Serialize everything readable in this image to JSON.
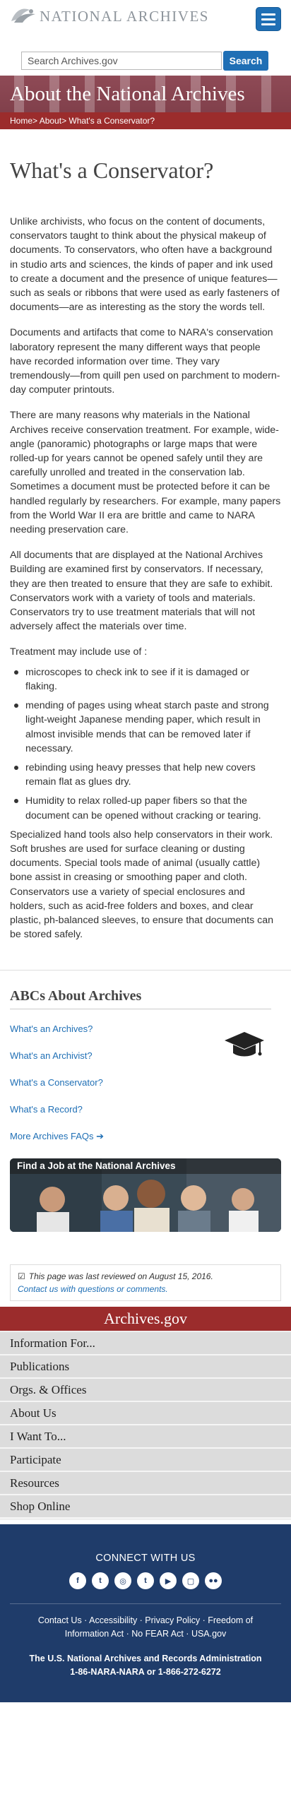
{
  "header": {
    "logo_text": "NATIONAL ARCHIVES",
    "menu_icon": "hamburger-icon",
    "search_placeholder": "Search Archives.gov",
    "search_button": "Search"
  },
  "banner": {
    "title": "About the National Archives",
    "breadcrumb": [
      "Home",
      ">",
      "About",
      ">",
      "What's a Conservator?"
    ]
  },
  "page": {
    "title": "What's a Conservator?",
    "paragraphs": [
      "Unlike archivists, who focus on the content of documents, conservators taught to think about the physical makeup of documents. To conservators, who often have a background in studio arts and sciences, the kinds of paper and ink used to create a document and the presence of unique features—such as seals or ribbons that were used as early fasteners of documents—are as interesting as the story the words tell.",
      "Documents and artifacts that come to NARA's conservation laboratory represent the many different ways that people have recorded information over time. They vary tremendously—from quill pen used on parchment to modern-day computer printouts.",
      "There are many reasons why materials in the National Archives receive conservation treatment. For example, wide-angle (panoramic) photographs or large maps that were rolled-up for years cannot be opened safely until they are carefully unrolled and treated in the conservation lab. Sometimes a document must be protected before it can be handled regularly by researchers. For example, many papers from the World War II era are brittle and came to NARA needing preservation care.",
      "All documents that are displayed at the National Archives Building are examined first by conservators. If necessary, they are then treated to ensure that they are safe to exhibit. Conservators work with a variety of tools and materials. Conservators try to use treatment materials that will not adversely affect the materials over time.",
      "Treatment may include use of :"
    ],
    "bullets": [
      "microscopes to check ink to see if it is damaged or flaking.",
      "mending of pages using wheat starch paste and strong light-weight Japanese mending paper, which result in almost invisible mends that can be removed later if necessary.",
      "rebinding using heavy presses that help new covers remain flat as glues dry.",
      "Humidity to relax rolled-up paper fibers so that the document can be opened without cracking or tearing."
    ],
    "closing": "Specialized hand tools also help conservators in their work. Soft brushes are used for surface cleaning or dusting documents. Special tools made of animal (usually cattle) bone assist in creasing or smoothing paper and cloth. Conservators use a variety of special enclosures and holders, such as acid-free folders and boxes, and clear plastic, ph-balanced sleeves, to ensure that documents can be stored safely."
  },
  "abc": {
    "title": "ABCs About Archives",
    "links": [
      "What's an Archives?",
      "What's an Archivist?",
      "What's a Conservator?",
      "What's a Record?"
    ],
    "more": "More Archives FAQs"
  },
  "job": {
    "label": "Find a Job at the National Archives"
  },
  "review": {
    "text": "This page was last reviewed on August 15, 2016.",
    "contact": "Contact us with questions or comments."
  },
  "archives_bar": "Archives.gov",
  "nav": [
    "Information For...",
    "Publications",
    "Orgs. & Offices",
    "About Us",
    "I Want To...",
    "Participate",
    "Resources",
    "Shop Online"
  ],
  "footer": {
    "connect": "CONNECT WITH US",
    "social": [
      "f",
      "t",
      "◎",
      "t",
      "▶",
      "▢",
      "●●"
    ],
    "links_line1": "Contact Us · Accessibility · Privacy Policy · Freedom of",
    "links_line2": "Information Act · No FEAR Act · USA.gov",
    "org": "The U.S. National Archives and Records Administration",
    "phone": "1-86-NARA-NARA or 1-866-272-6272"
  },
  "colors": {
    "brand_blue": "#1f6fb5",
    "banner_red": "#9b2c2c",
    "footer_navy": "#1f3c6a"
  }
}
